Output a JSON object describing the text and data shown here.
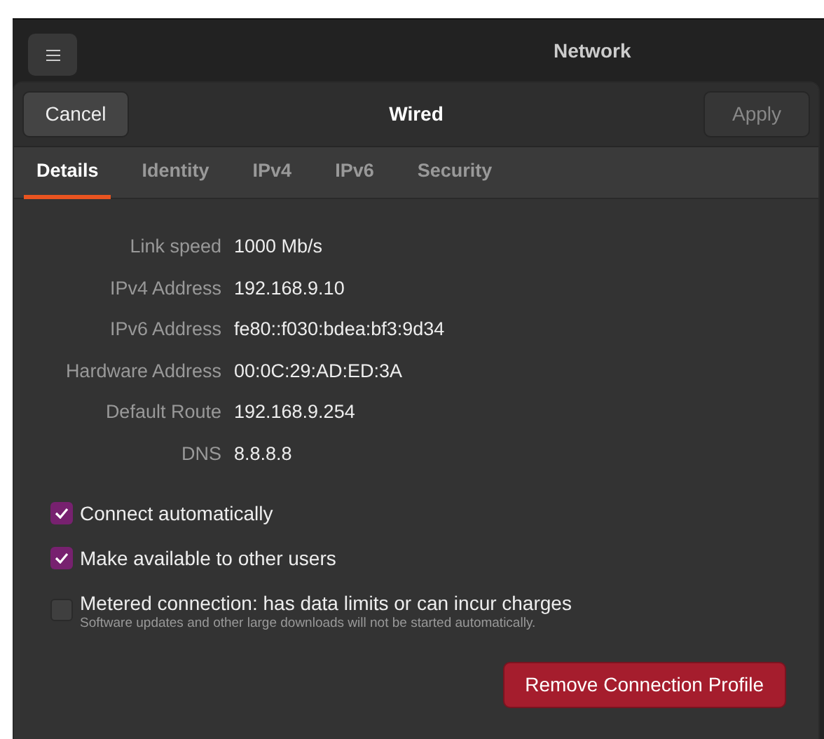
{
  "window": {
    "title": "Network"
  },
  "dialog": {
    "title": "Wired",
    "cancel_button": "Cancel",
    "apply_button": {
      "label": "Apply",
      "disabled": true
    }
  },
  "tabs": [
    {
      "label": "Details",
      "selected": true
    },
    {
      "label": "Identity",
      "selected": false
    },
    {
      "label": "IPv4",
      "selected": false
    },
    {
      "label": "IPv6",
      "selected": false
    },
    {
      "label": "Security",
      "selected": false
    }
  ],
  "details": [
    {
      "label": "Link speed",
      "value": "1000 Mb/s"
    },
    {
      "label": "IPv4 Address",
      "value": "192.168.9.10"
    },
    {
      "label": "IPv6 Address",
      "value": "fe80::f030:bdea:bf3:9d34"
    },
    {
      "label": "Hardware Address",
      "value": "00:0C:29:AD:ED:3A"
    },
    {
      "label": "Default Route",
      "value": "192.168.9.254"
    },
    {
      "label": "DNS",
      "value": "8.8.8.8"
    }
  ],
  "options": [
    {
      "label": "Connect automatically",
      "checked": true
    },
    {
      "label": "Make available to other users",
      "checked": true
    },
    {
      "label": "Metered connection: has data limits or can incur charges",
      "hint": "Software updates and other large downloads will not be started automatically.",
      "checked": false
    }
  ],
  "remove_button": "Remove Connection Profile"
}
